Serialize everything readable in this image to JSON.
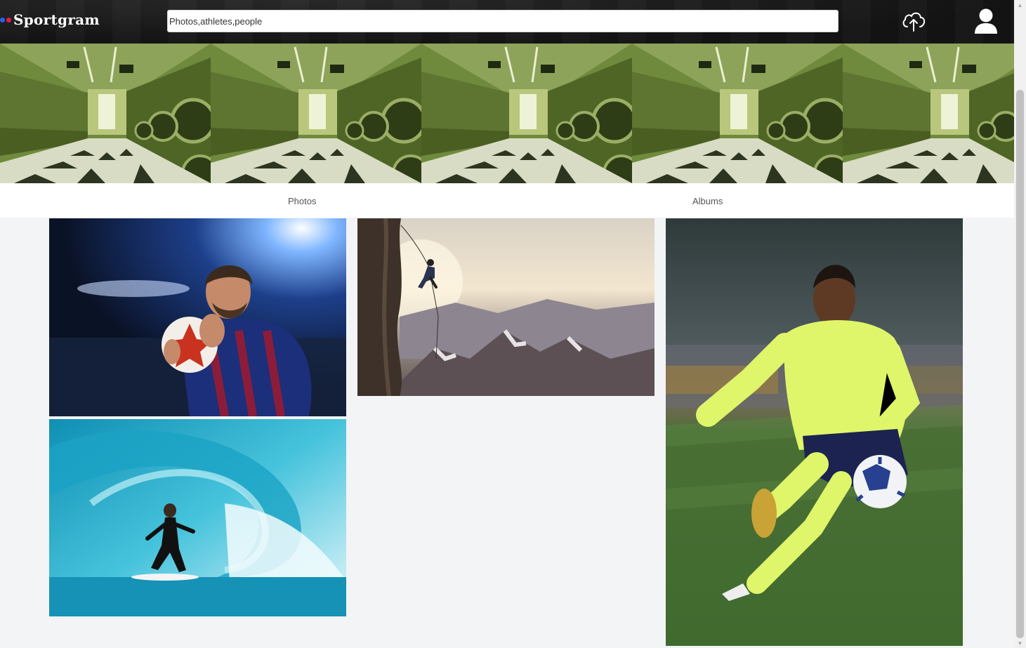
{
  "header": {
    "brand": "Sportgram",
    "search_placeholder": "Photos,athletes,people"
  },
  "tabs": [
    {
      "label": "Photos"
    },
    {
      "label": "Albums"
    }
  ],
  "colors": {
    "topbar": "#151515",
    "page_background": "#f3f4f6",
    "logo_dot_red": "#e11d48",
    "logo_dot_blue": "#2563eb",
    "laundromat_green": "#8fa35a"
  },
  "icons": {
    "upload": "cloud-upload-icon",
    "profile": "user-avatar-icon"
  },
  "banner": {
    "tiles": 5
  },
  "gallery": {
    "photos": [
      "soccer player holding ball in stadium",
      "surfer riding inside a wave barrel",
      "climber rappelling off a cliff above mountains",
      "soccer player striking the ball on grass"
    ]
  }
}
